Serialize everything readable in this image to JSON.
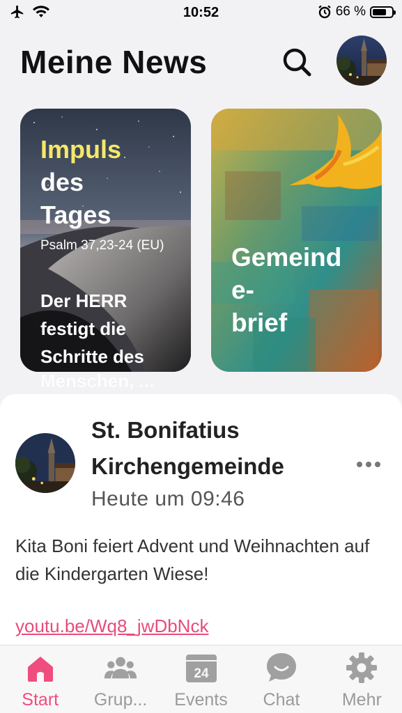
{
  "status_bar": {
    "time": "10:52",
    "battery_percent": "66 %",
    "left_icons": [
      "airplane-icon",
      "wifi-icon"
    ],
    "right_icons": [
      "alarm-icon",
      "battery-icon"
    ]
  },
  "header": {
    "title": "Meine News",
    "search_icon": "search-icon",
    "avatar": "church-avatar"
  },
  "cards": {
    "impuls": {
      "title_highlight": "Impuls",
      "title_rest_1": "des",
      "title_rest_2": "Tages",
      "reference": "Psalm 37,23-24 (EU)",
      "verse": "Der HERR festigt die Schritte des",
      "verse_overflow": "Menschen, ...",
      "highlight_color": "#f5e86a"
    },
    "gemeindebrief": {
      "title_line_1": "Gemeind",
      "title_line_2": "e-",
      "title_line_3": "brief",
      "icon": "dove-icon"
    }
  },
  "post": {
    "author": "St. Bonifatius Kirchengemeinde",
    "time": "Heute um 09:46",
    "text": "Kita Boni feiert Advent und Weihnachten auf die Kindergarten Wiese!",
    "link": "youtu.be/Wq8_jwDbNck",
    "link_color": "#e64c7a"
  },
  "tabbar": {
    "active_color": "#ef4d7d",
    "items": [
      {
        "label": "Start",
        "icon": "home-icon",
        "active": true
      },
      {
        "label": "Grup...",
        "icon": "groups-icon",
        "active": false
      },
      {
        "label": "Events",
        "icon": "calendar-icon",
        "calendar_day": "24",
        "active": false
      },
      {
        "label": "Chat",
        "icon": "chat-icon",
        "active": false
      },
      {
        "label": "Mehr",
        "icon": "gear-icon",
        "active": false
      }
    ]
  }
}
